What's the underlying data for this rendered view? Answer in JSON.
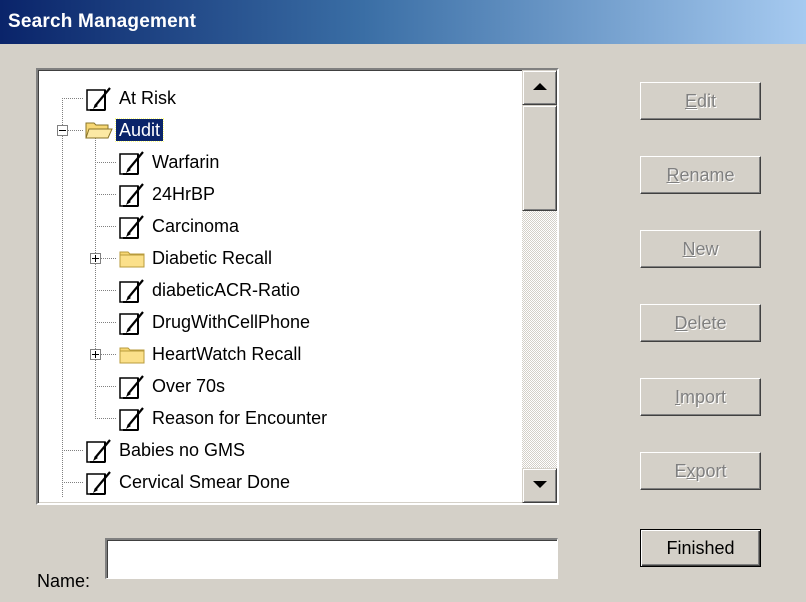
{
  "window": {
    "title": "Search Management"
  },
  "tree": {
    "nodes": [
      {
        "label": "At Risk",
        "type": "search",
        "depth": 0
      },
      {
        "label": "Audit",
        "type": "folder",
        "depth": 0,
        "expanded": true,
        "selected": true
      },
      {
        "label": "Warfarin",
        "type": "search",
        "depth": 1
      },
      {
        "label": "24HrBP",
        "type": "search",
        "depth": 1
      },
      {
        "label": "Carcinoma",
        "type": "search",
        "depth": 1
      },
      {
        "label": "Diabetic Recall",
        "type": "folder",
        "depth": 1,
        "expanded": false
      },
      {
        "label": "diabeticACR-Ratio",
        "type": "search",
        "depth": 1
      },
      {
        "label": "DrugWithCellPhone",
        "type": "search",
        "depth": 1
      },
      {
        "label": "HeartWatch Recall",
        "type": "folder",
        "depth": 1,
        "expanded": false
      },
      {
        "label": "Over 70s",
        "type": "search",
        "depth": 1
      },
      {
        "label": "Reason for Encounter",
        "type": "search",
        "depth": 1
      },
      {
        "label": "Babies no GMS",
        "type": "search",
        "depth": 0
      },
      {
        "label": "Cervical Smear Done",
        "type": "search",
        "depth": 0
      }
    ]
  },
  "buttons": {
    "edit": {
      "label": "Edit",
      "access_key": "E",
      "enabled": false
    },
    "rename": {
      "label": "Rename",
      "access_key": "R",
      "enabled": false
    },
    "new": {
      "label": "New",
      "access_key": "N",
      "enabled": false
    },
    "delete": {
      "label": "Delete",
      "access_key": "D",
      "enabled": false
    },
    "import": {
      "label": "Import",
      "access_key": "I",
      "enabled": false
    },
    "export": {
      "label": "Export",
      "access_key": "x",
      "enabled": false
    },
    "finished": {
      "label": "Finished",
      "enabled": true
    }
  },
  "name_field": {
    "label": "Name:",
    "access_key": "m",
    "value": ""
  },
  "colors": {
    "title_gradient_start": "#0a246a",
    "title_gradient_end": "#a6caf0",
    "selection": "#0a246a",
    "face": "#d4d0c8"
  },
  "icons": {
    "search": "search-document-icon",
    "folder_open": "folder-open-icon",
    "folder_closed": "folder-closed-icon"
  }
}
